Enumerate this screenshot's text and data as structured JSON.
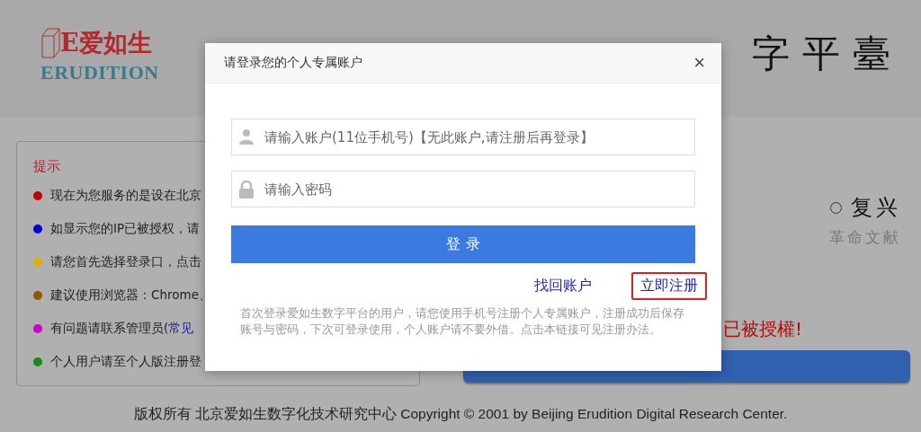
{
  "header": {
    "logo": {
      "cn": "E爱如生",
      "en": "ERUDITION"
    },
    "title": "字平臺"
  },
  "tips": {
    "title": "提示",
    "items": [
      {
        "color": "#c00000",
        "text": "现在为您服务的是设在北京"
      },
      {
        "color": "#0000cc",
        "text": "如显示您的IP已被授权，请"
      },
      {
        "color": "#e0b000",
        "text": "请您首先选择登录口，点击"
      },
      {
        "color": "#8b5a00",
        "text": "建议使用浏览器：Chrome、"
      },
      {
        "color": "#cc00cc",
        "text": "有问题请联系管理员(",
        "link": "常见"
      },
      {
        "color": "#1a8a1a",
        "text": "个人用户请至个人版注册登"
      }
    ]
  },
  "collections": [
    {
      "label": "复兴",
      "sublabel": "革命文献",
      "selected": false
    }
  ],
  "auth_notice": "已被授權!",
  "footer": "版权所有 北京爱如生数字化技术研究中心 Copyright © 2001 by Beijing Erudition Digital Research Center.",
  "dialog": {
    "title": "请登录您的个人专属账户",
    "close": "×",
    "account": {
      "placeholder": "请输入账户(11位手机号)【无此账户,请注册后再登录】"
    },
    "password": {
      "placeholder": "请输入密码"
    },
    "login": "登 录",
    "links": [
      {
        "label": "找回账户",
        "highlighted": false
      },
      {
        "label": "立即注册",
        "highlighted": true
      }
    ],
    "note": "首次登录爱如生数字平台的用户，请您使用手机号注册个人专属账户，注册成功后保存账号与密码，下次可登录使用，个人账户请不要外借。点击本链接可见注册办法。"
  }
}
